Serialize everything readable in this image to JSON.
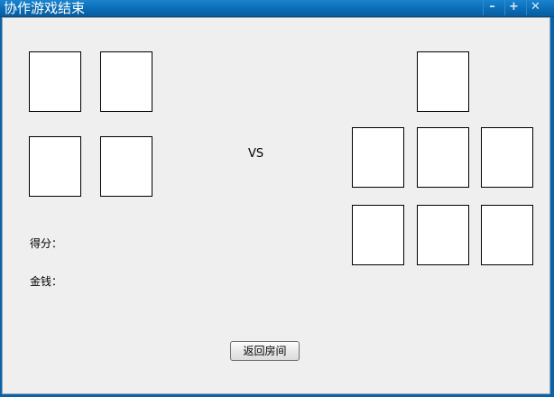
{
  "window": {
    "title": "协作游戏结束",
    "minimize_glyph": "–",
    "maximize_glyph": "+",
    "close_glyph": "✕"
  },
  "main": {
    "vs_label": "VS",
    "score_label": "得分：",
    "money_label": "金钱：",
    "back_button_label": "返回房间"
  }
}
